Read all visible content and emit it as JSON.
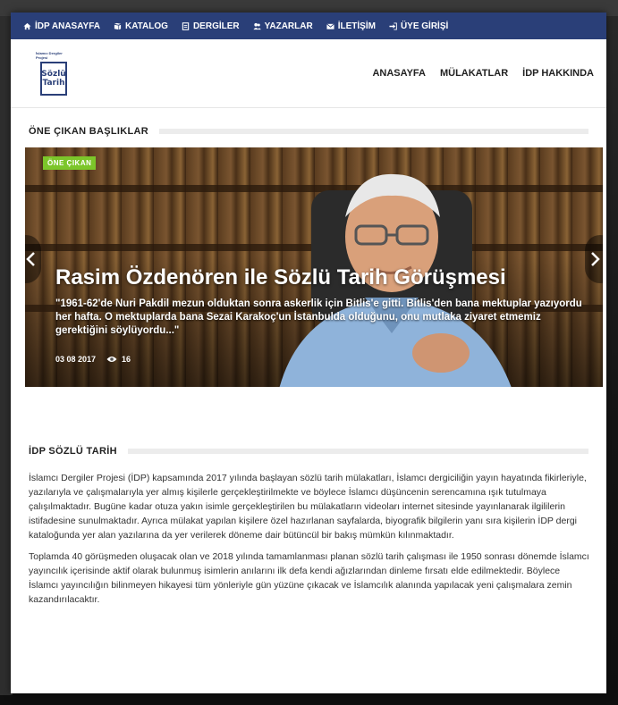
{
  "topbar": {
    "items": [
      {
        "label": "İDP ANASAYFA",
        "icon": "home-icon"
      },
      {
        "label": "KATALOG",
        "icon": "book-icon"
      },
      {
        "label": "DERGİLER",
        "icon": "document-icon"
      },
      {
        "label": "YAZARLAR",
        "icon": "users-icon"
      },
      {
        "label": "İLETİŞİM",
        "icon": "envelope-icon"
      },
      {
        "label": "ÜYE GİRİŞİ",
        "icon": "sign-in-icon"
      }
    ]
  },
  "logo": {
    "small_text": "İslamcı Dergiler Projesi",
    "word1": "Sözlü",
    "word2": "Tarih"
  },
  "mainnav": {
    "items": [
      "ANASAYFA",
      "MÜLAKATLAR",
      "İDP HAKKINDA"
    ]
  },
  "featured": {
    "heading": "ÖNE ÇIKAN BAŞLIKLAR",
    "badge": "ÖNE ÇIKAN",
    "title": "Rasim Özdenören ile Sözlü Tarih Görüşmesi",
    "excerpt": "\"1961-62'de Nuri Pakdil mezun olduktan sonra askerlik için Bitlis'e gitti. Bitlis'den bana mektuplar yazıyordu her hafta. O mektuplarda bana Sezai Karakoç'un İstanbulda olduğunu, onu mutlaka ziyaret etmemiz gerektiğini söylüyordu...\"",
    "date": "03 08 2017",
    "views": "16"
  },
  "about": {
    "heading": "İDP SÖZLÜ TARİH",
    "paragraphs": [
      "İslamcı Dergiler Projesi (İDP) kapsamında 2017 yılında başlayan sözlü tarih mülakatları, İslamcı dergiciliğin yayın hayatında fikirleriyle, yazılarıyla ve çalışmalarıyla yer almış kişilerle gerçekleştirilmekte ve böylece İslamcı düşüncenin serencamına ışık tutulmaya çalışılmaktadır. Bugüne kadar otuza yakın isimle gerçekleştirilen bu mülakatların videoları internet sitesinde yayınlanarak ilgililerin istifadesine sunulmaktadır. Ayrıca mülakat yapılan kişilere özel hazırlanan sayfalarda, biyografik bilgilerin yanı sıra kişilerin İDP dergi kataloğunda yer alan yazılarına da yer verilerek döneme dair bütüncül bir bakış mümkün kılınmaktadır.",
      "Toplamda 40 görüşmeden oluşacak olan ve 2018 yılında tamamlanması planan sözlü tarih çalışması ile 1950 sonrası dönemde İslamcı yayıncılık içerisinde aktif olarak bulunmuş isimlerin anılarını ilk defa kendi ağızlarından dinleme fırsatı elde edilmektedir. Böylece İslamcı yayıncılığın bilinmeyen hikayesi tüm yönleriyle gün yüzüne çıkacak ve İslamcılık alanında yapılacak yeni çalışmalara zemin kazandırılacaktır."
    ]
  },
  "colors": {
    "topbar": "#2a3f78",
    "badge": "#7cc62a",
    "text": "#333333"
  }
}
